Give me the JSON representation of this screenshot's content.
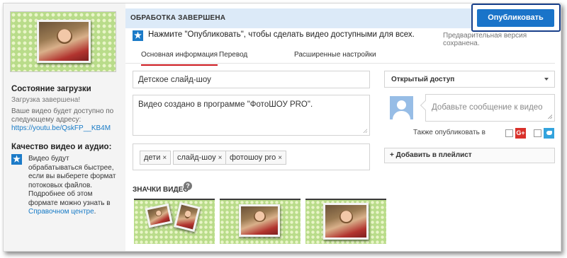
{
  "header": {
    "status_title": "ОБРАБОТКА ЗАВЕРШЕНА",
    "publish_label": "Опубликовать",
    "notice_text": "Нажмите \"Опубликовать\", чтобы сделать видео доступными для всех.",
    "saved_text": "Предварительная версия сохранена."
  },
  "tabs": [
    {
      "label": "Основная информация",
      "active": true
    },
    {
      "label": "Перевод",
      "active": false
    },
    {
      "label": "Расширенные настройки",
      "active": false
    }
  ],
  "sidebar": {
    "upload_status_title": "Состояние загрузки",
    "upload_status_text": "Загрузка завершена!",
    "address_text_1": "Ваше видео будет доступно по",
    "address_text_2": "следующему адресу:",
    "video_url": "https://youtu.be/QskFP__KB4M",
    "quality_title": "Качество видео и аудио:",
    "quality_lines": [
      "Видео будут",
      "обрабатываться быстрее,",
      "если вы выберете формат",
      "потоковых файлов.",
      "Подробнее об этом",
      "формате можно узнать в"
    ],
    "help_center_link": "Справочном центре",
    "help_center_suffix": "."
  },
  "form": {
    "title_value": "Детское слайд-шоу",
    "description_value": "Видео создано в программе \"ФотоШОУ PRO\".",
    "tags": [
      "дети",
      "слайд-шоу",
      "фотошоу pro"
    ],
    "tag_remove_symbol": "×",
    "thumbnails_title": "ЗНАЧКИ ВИДЕО",
    "help_symbol": "?"
  },
  "right_panel": {
    "privacy_value": "Открытый доступ",
    "message_placeholder": "Добавьте сообщение к видео",
    "also_publish_label": "Также опубликовать в",
    "gplus_label": "G+",
    "add_playlist_label": "+ Добавить в плейлист"
  },
  "icons": {
    "star": "★"
  },
  "colors": {
    "accent_blue": "#1a74c9",
    "header_bg": "#dceaf8",
    "active_tab_underline": "#cc181e",
    "link": "#167ac6",
    "thumbnail_green": "#b9dc8a"
  }
}
